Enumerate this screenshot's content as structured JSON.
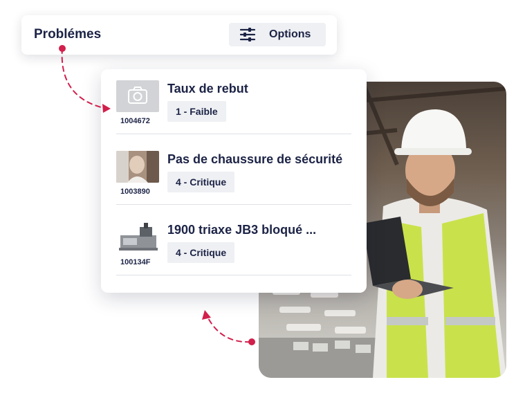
{
  "header": {
    "title": "Problémes",
    "options_label": "Options",
    "options_icon": "sliders-icon"
  },
  "problems": [
    {
      "id": "1004672",
      "title": "Taux de rebut",
      "severity": "1 - Faible",
      "thumbnail": "camera-placeholder-icon"
    },
    {
      "id": "1003890",
      "title": "Pas de chaussure de sécurité",
      "severity": "4 - Critique",
      "thumbnail": "person-photo"
    },
    {
      "id": "100134F",
      "title": "1900 triaxe JB3 bloqué ...",
      "severity": "4 - Critique",
      "thumbnail": "machine-photo"
    }
  ],
  "colors": {
    "title": "#1c2346",
    "accent": "#d21f4b",
    "chip_bg": "#eef0f3"
  }
}
